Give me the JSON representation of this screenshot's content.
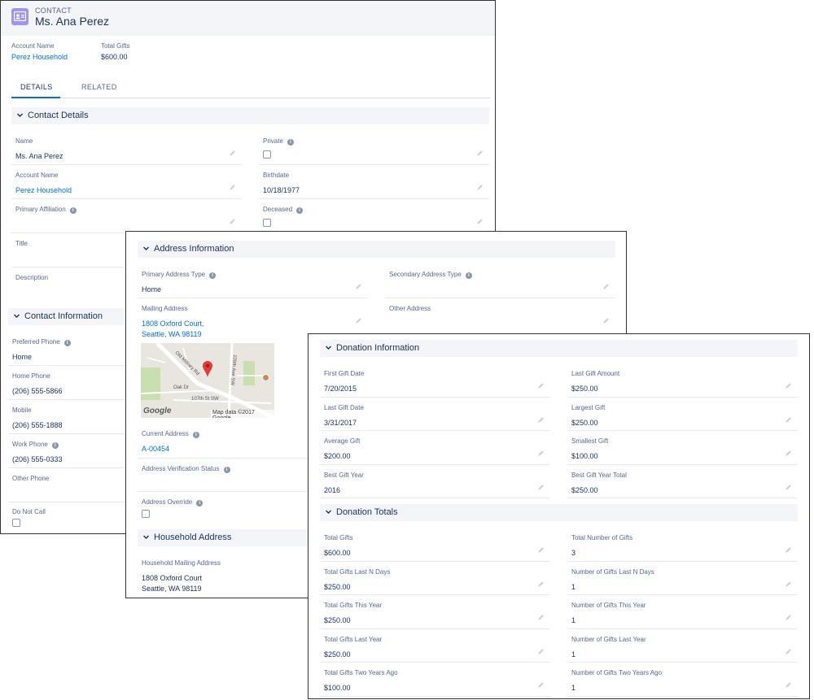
{
  "record": {
    "type": "CONTACT",
    "name": "Ms. Ana Perez"
  },
  "header_fields": [
    {
      "label": "Account Name",
      "value": "Perez Household"
    },
    {
      "label": "Total Gifts",
      "value": "$600.00"
    }
  ],
  "tabs": [
    {
      "label": "DETAILS"
    },
    {
      "label": "RELATED"
    }
  ],
  "contact_details": {
    "title": "Contact Details",
    "name": {
      "label": "Name",
      "value": "Ms. Ana Perez"
    },
    "private": {
      "label": "Private",
      "checked": false
    },
    "account_name": {
      "label": "Account Name",
      "value": "Perez Household"
    },
    "birthdate": {
      "label": "Birthdate",
      "value": "10/18/1977"
    },
    "primary_affiliation": {
      "label": "Primary Affiliation",
      "value": ""
    },
    "deceased": {
      "label": "Deceased",
      "checked": false
    },
    "title_field": {
      "label": "Title",
      "value": ""
    },
    "description": {
      "label": "Description",
      "value": ""
    }
  },
  "contact_information": {
    "title": "Contact Information",
    "preferred_phone": {
      "label": "Preferred Phone",
      "value": "Home"
    },
    "home_phone": {
      "label": "Home Phone",
      "value": "(206) 555-5866"
    },
    "mobile": {
      "label": "Mobile",
      "value": "(206) 555-1888"
    },
    "work_phone": {
      "label": "Work Phone",
      "value": "(206) 555-0333"
    },
    "other_phone": {
      "label": "Other Phone",
      "value": ""
    },
    "do_not_call": {
      "label": "Do Not Call",
      "checked": false
    }
  },
  "address_information": {
    "title": "Address Information",
    "primary_address_type": {
      "label": "Primary Address Type",
      "value": "Home"
    },
    "secondary_address_type": {
      "label": "Secondary Address Type",
      "value": ""
    },
    "mailing_address": {
      "label": "Mailing Address",
      "value": "1808 Oxford Court,\nSeattle, WA 98119"
    },
    "other_address": {
      "label": "Other Address",
      "value": ""
    },
    "map": {
      "brand": "Google",
      "credit": "Map data ©2017 Google",
      "streets": [
        "Old Military Rd",
        "109th Ave SW",
        "Oak Dr",
        "107th St SW"
      ]
    },
    "current_address": {
      "label": "Current Address",
      "value": "A-00454"
    },
    "address_verification_status": {
      "label": "Address Verification Status",
      "value": ""
    },
    "address_override": {
      "label": "Address Override",
      "checked": false
    }
  },
  "household_address": {
    "title": "Household Address",
    "household_mailing_address": {
      "label": "Household Mailing Address",
      "value": "1808 Oxford Court\nSeattle, WA 98119"
    }
  },
  "donation_information": {
    "title": "Donation Information",
    "fields": [
      {
        "label": "First Gift Date",
        "value": "7/20/2015"
      },
      {
        "label": "Last Gift Amount",
        "value": "$250.00"
      },
      {
        "label": "Last Gift Date",
        "value": "3/31/2017"
      },
      {
        "label": "Largest Gift",
        "value": "$250.00"
      },
      {
        "label": "Average Gift",
        "value": "$200.00"
      },
      {
        "label": "Smallest Gift",
        "value": "$100.00"
      },
      {
        "label": "Best Gift Year",
        "value": "2016"
      },
      {
        "label": "Best Gift Year Total",
        "value": "$250.00"
      }
    ]
  },
  "donation_totals": {
    "title": "Donation Totals",
    "fields": [
      {
        "label": "Total Gifts",
        "value": "$600.00"
      },
      {
        "label": "Total Number of Gifts",
        "value": "3"
      },
      {
        "label": "Total Gifts Last N Days",
        "value": "$250.00"
      },
      {
        "label": "Number of Gifts Last N Days",
        "value": "1"
      },
      {
        "label": "Total Gifts This Year",
        "value": "$250.00"
      },
      {
        "label": "Number of Gifts This Year",
        "value": "1"
      },
      {
        "label": "Total Gifts Last Year",
        "value": "$250.00"
      },
      {
        "label": "Number of Gifts Last Year",
        "value": "1"
      },
      {
        "label": "Total Gifts Two Years Ago",
        "value": "$100.00"
      },
      {
        "label": "Number of Gifts Two Years Ago",
        "value": "1"
      }
    ]
  }
}
